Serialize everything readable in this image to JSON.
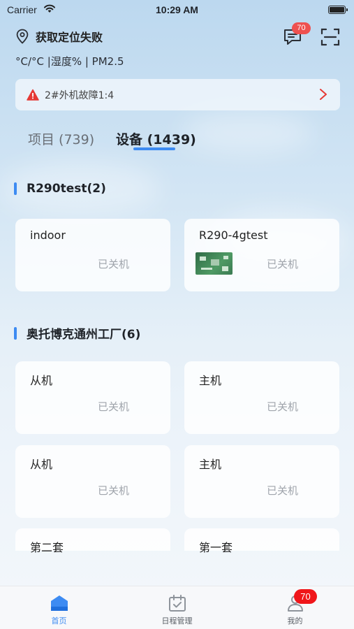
{
  "status_bar": {
    "carrier": "Carrier",
    "time": "10:29 AM"
  },
  "header": {
    "location_text": "获取定位失败",
    "weather_text": "°C/°C |湿度% | PM2.5",
    "message_badge": "70"
  },
  "alert": {
    "text": "2#外机故障1:4"
  },
  "tabs": [
    {
      "label": "项目 (739)",
      "active": false
    },
    {
      "label": "设备 (1439)",
      "active": true
    }
  ],
  "groups": [
    {
      "name": "R290test(2)",
      "devices": [
        {
          "name": "indoor",
          "status": "已关机"
        },
        {
          "name": "R290-4gtest",
          "status": "已关机"
        }
      ]
    },
    {
      "name": "奥托博克通州工厂(6)",
      "devices": [
        {
          "name": "从机",
          "status": "已关机"
        },
        {
          "name": "主机",
          "status": "已关机"
        },
        {
          "name": "从机",
          "status": "已关机"
        },
        {
          "name": "主机",
          "status": "已关机"
        },
        {
          "name": "第二套",
          "status": ""
        },
        {
          "name": "第一套",
          "status": ""
        }
      ]
    }
  ],
  "bottom_nav": {
    "items": [
      {
        "label": "首页",
        "icon": "home-icon",
        "active": true
      },
      {
        "label": "日程管理",
        "icon": "calendar-icon",
        "active": false
      },
      {
        "label": "我的",
        "icon": "profile-icon",
        "active": false
      }
    ],
    "profile_badge": "70"
  },
  "colors": {
    "accent": "#3d8bf2",
    "badge": "#ee5150",
    "alert_icon": "#e53935",
    "status_text": "#9fa4ab"
  }
}
